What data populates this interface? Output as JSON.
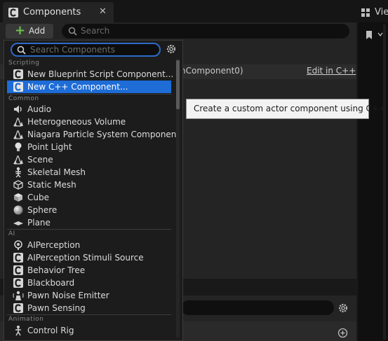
{
  "tab": {
    "title": "Components",
    "close": "✕"
  },
  "right_tab": {
    "label": "Vie"
  },
  "toolbar": {
    "add_label": "Add",
    "plus": "+",
    "search_placeholder": "Search"
  },
  "details": {
    "component_partial": "hComponent0)",
    "edit_cpp": "Edit in C++"
  },
  "menu": {
    "search_placeholder": "Search Components",
    "scripting": {
      "header": "Scripting",
      "items": [
        {
          "label": "New Blueprint Script Component...",
          "icon": "blueprint-c-icon"
        },
        {
          "label": "New C++ Component...",
          "icon": "cpp-c-icon",
          "selected": true
        }
      ]
    },
    "common": {
      "header": "Common",
      "items": [
        {
          "label": "Audio",
          "icon": "speaker-icon"
        },
        {
          "label": "Heterogeneous Volume",
          "icon": "actor-icon"
        },
        {
          "label": "Niagara Particle System Component",
          "icon": "actor-icon"
        },
        {
          "label": "Point Light",
          "icon": "light-bulb-icon"
        },
        {
          "label": "Scene",
          "icon": "actor-icon"
        },
        {
          "label": "Skeletal Mesh",
          "icon": "skeleton-icon"
        },
        {
          "label": "Static Mesh",
          "icon": "mesh-icon"
        },
        {
          "label": "Cube",
          "icon": "cube-icon"
        },
        {
          "label": "Sphere",
          "icon": "sphere-icon"
        },
        {
          "label": "Plane",
          "icon": "plane-icon"
        }
      ]
    },
    "ai": {
      "header": "AI",
      "items": [
        {
          "label": "AIPerception",
          "icon": "perception-icon"
        },
        {
          "label": "AIPerception Stimuli Source",
          "icon": "c-class-icon"
        },
        {
          "label": "Behavior Tree",
          "icon": "c-class-icon"
        },
        {
          "label": "Blackboard",
          "icon": "c-class-icon"
        },
        {
          "label": "Pawn Noise Emitter",
          "icon": "noise-emitter-icon"
        },
        {
          "label": "Pawn Sensing",
          "icon": "c-class-icon"
        }
      ]
    },
    "animation": {
      "header": "Animation",
      "items": [
        {
          "label": "Control Rig",
          "icon": "control-rig-icon"
        }
      ]
    }
  },
  "tooltip": {
    "text": "Create a custom actor component using C++"
  },
  "colors": {
    "accent": "#1e6cd6",
    "add_plus": "#6ec150",
    "search_focus": "#2e6ac8"
  }
}
